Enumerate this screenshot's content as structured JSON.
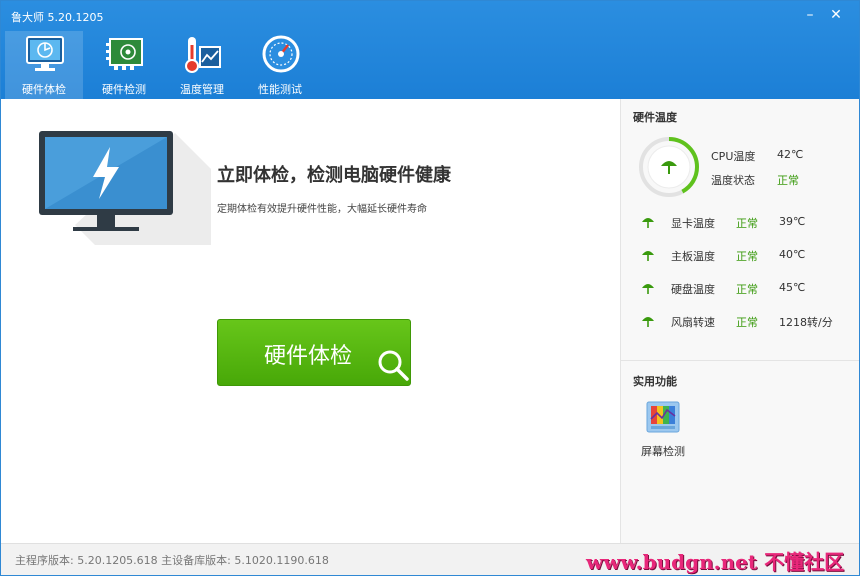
{
  "window": {
    "title": "鲁大师 5.20.1205",
    "minimize": "–",
    "close": "✕"
  },
  "tabs": [
    {
      "label": "硬件体检",
      "icon": "monitor-check-icon",
      "active": true
    },
    {
      "label": "硬件检测",
      "icon": "hardware-board-icon",
      "active": false
    },
    {
      "label": "温度管理",
      "icon": "thermometer-icon",
      "active": false
    },
    {
      "label": "性能测试",
      "icon": "speedometer-icon",
      "active": false
    }
  ],
  "main": {
    "headline": "立即体检，检测电脑硬件健康",
    "subline": "定期体检有效提升硬件性能，大幅延长硬件寿命",
    "check_button": "硬件体检"
  },
  "right_panel": {
    "temp_title": "硬件温度",
    "cpu": {
      "temp_label": "CPU温度",
      "temp_value": "42℃",
      "status_label": "温度状态",
      "status_value": "正常",
      "gauge_fraction": 0.42
    },
    "rows": [
      {
        "name": "显卡温度",
        "status": "正常",
        "value": "39℃"
      },
      {
        "name": "主板温度",
        "status": "正常",
        "value": "40℃"
      },
      {
        "name": "硬盘温度",
        "status": "正常",
        "value": "45℃"
      },
      {
        "name": "风扇转速",
        "status": "正常",
        "value": "1218转/分"
      }
    ],
    "tools_title": "实用功能",
    "tools": [
      {
        "label": "屏幕检测",
        "icon": "screen-test-icon"
      }
    ]
  },
  "statusbar": {
    "text": "主程序版本: 5.20.1205.618   主设备库版本: 5.1020.1190.618",
    "watermark": "www.budgn.net 不懂社区"
  },
  "colors": {
    "header": "#1c7fd6",
    "accent_green": "#48a808",
    "status_green": "#3a9a0e"
  }
}
